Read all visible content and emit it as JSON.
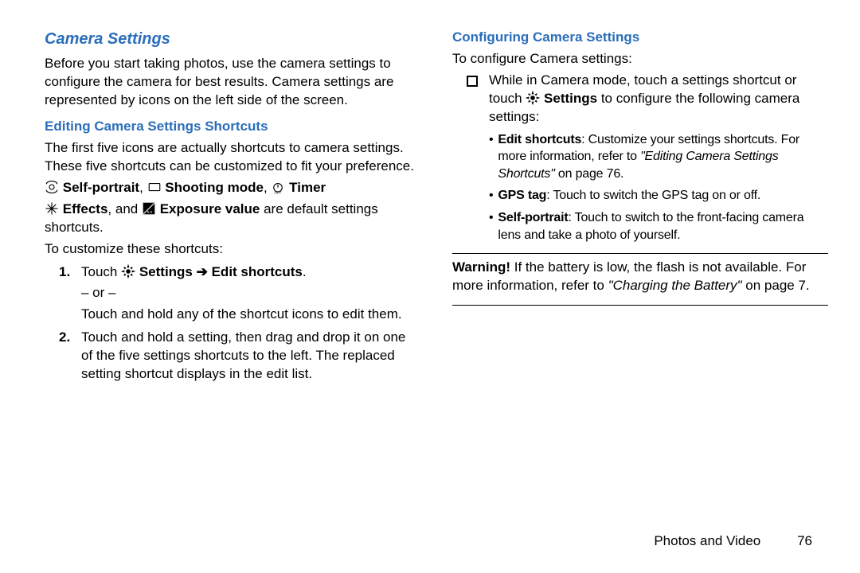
{
  "left": {
    "title": "Camera Settings",
    "intro": "Before you start taking photos, use the camera settings to configure the camera for best results. Camera settings are represented by icons on the left side of the screen.",
    "sub1": "Editing Camera Settings Shortcuts",
    "sub1_p": "The first five icons are actually shortcuts to camera settings. These five shortcuts can be customized to fit your preference.",
    "defaults": {
      "self_portrait": "Self-portrait",
      "sep1": ",  ",
      "shooting_mode": "Shooting mode",
      "sep2": ",  ",
      "timer": "Timer",
      "effects": "Effects",
      "and": ", and  ",
      "exposure": "Exposure value",
      "tail": " are default settings shortcuts."
    },
    "customize_lead": "To customize these shortcuts:",
    "step1_a": "Touch ",
    "step1_settings": "Settings",
    "step1_arrow": " ➔ ",
    "step1_edit": "Edit shortcuts",
    "step1_period": ".",
    "step1_or": "– or –",
    "step1_b": "Touch and hold any of the shortcut icons to edit them.",
    "step2": "Touch and hold a setting, then drag and drop it on one of the five settings shortcuts to the left. The replaced setting shortcut displays in the edit list."
  },
  "right": {
    "sub": "Configuring Camera Settings",
    "lead": "To configure Camera settings:",
    "bullet1_a": "While in Camera mode, touch a settings shortcut or touch ",
    "bullet1_settings": "Settings",
    "bullet1_b": " to configure the following camera settings:",
    "d1_label": "Edit shortcuts",
    "d1_body": ": Customize your settings shortcuts. For more information, refer to ",
    "d1_ref": "\"Editing Camera Settings Shortcuts\"",
    "d1_tail": " on page 76.",
    "d2_label": "GPS tag",
    "d2_body": ": Touch to switch the GPS tag on or off.",
    "d3_label": "Self-portrait",
    "d3_body": ": Touch to switch to the front-facing camera lens and take a photo of yourself.",
    "warn_label": "Warning!",
    "warn_body_a": " If the battery is low, the flash is not available. For more information, refer to ",
    "warn_ref": "\"Charging the Battery\"",
    "warn_body_b": " on page 7."
  },
  "footer": {
    "section": "Photos and Video",
    "page": "76"
  }
}
